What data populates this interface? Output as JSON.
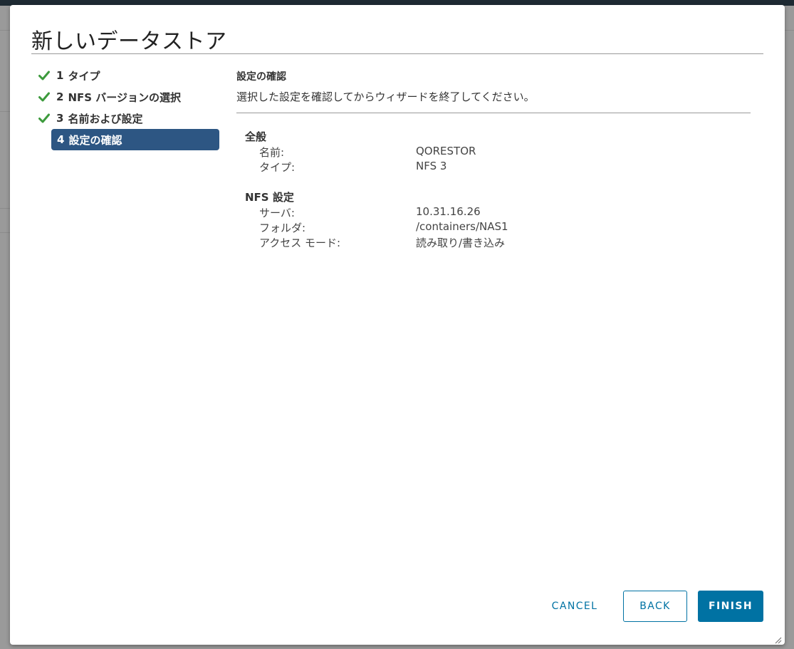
{
  "modal": {
    "title": "新しいデータストア"
  },
  "steps": [
    {
      "number": "1",
      "label": "タイプ",
      "completed": true
    },
    {
      "number": "2",
      "label": "NFS バージョンの選択",
      "completed": true
    },
    {
      "number": "3",
      "label": "名前および設定",
      "completed": true
    },
    {
      "number": "4",
      "label": "設定の確認",
      "completed": false,
      "active": true
    }
  ],
  "review": {
    "title": "設定の確認",
    "description": "選択した設定を確認してからウィザードを終了してください。"
  },
  "general": {
    "heading": "全般",
    "rows": [
      {
        "key": "名前:",
        "value": "QORESTOR"
      },
      {
        "key": "タイプ:",
        "value": "NFS 3"
      }
    ]
  },
  "nfs": {
    "heading": "NFS 設定",
    "rows": [
      {
        "key": "サーバ:",
        "value": "10.31.16.26"
      },
      {
        "key": "フォルダ:",
        "value": "/containers/NAS1"
      },
      {
        "key": "アクセス モード:",
        "value": "読み取り/書き込み"
      }
    ]
  },
  "buttons": {
    "cancel": "CANCEL",
    "back": "BACK",
    "finish": "FINISH"
  },
  "colors": {
    "accent": "#0072a3",
    "active_step": "#2d5683",
    "check": "#3c9a3c"
  }
}
